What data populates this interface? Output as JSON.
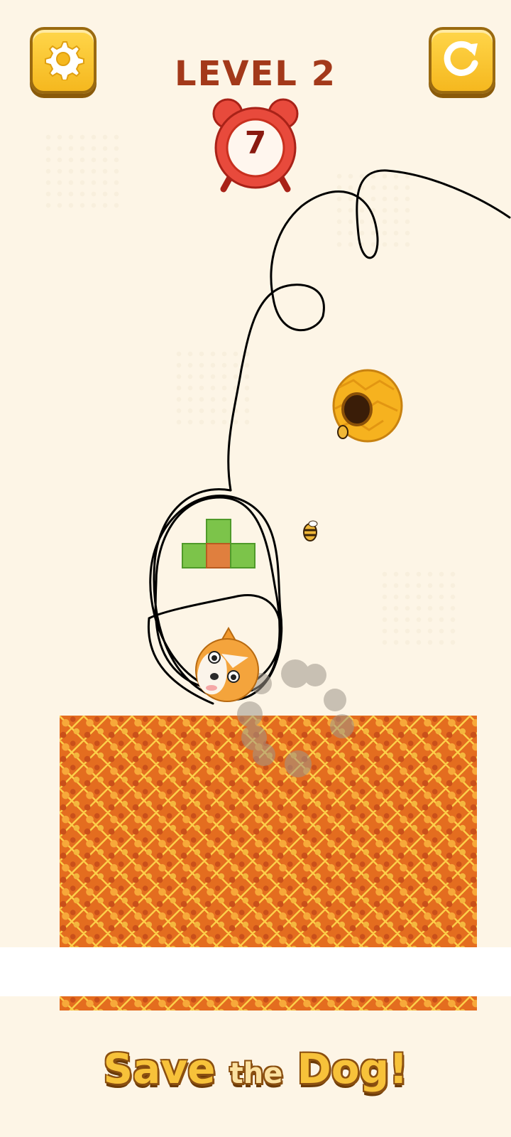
{
  "header": {
    "level_label": "LEVEL 2",
    "timer_value": "7",
    "settings_icon": "gear-icon",
    "restart_icon": "restart-icon"
  },
  "scene": {
    "hazards": [
      "beehive",
      "bee"
    ],
    "drawn_line_color": "#000000",
    "lava_color": "#e46d1f"
  },
  "footer": {
    "logo_part1": "Save",
    "logo_part2": "the",
    "logo_part3": "Dog!"
  },
  "colors": {
    "background": "#fdf5e6",
    "button_fill": "#ffd64a",
    "level_text": "#a3391a",
    "timer_red": "#e84a3c"
  }
}
